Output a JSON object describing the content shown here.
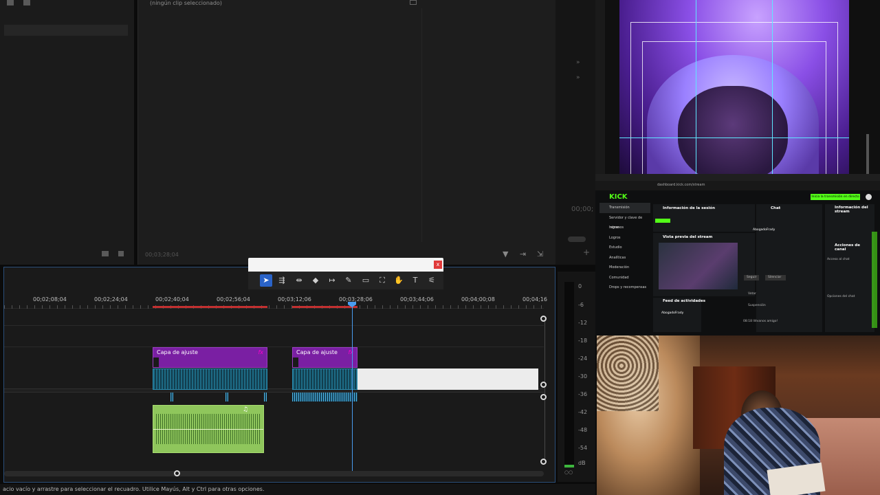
{
  "source_monitor": {
    "title": "(ningún clip seleccionado)",
    "timecode": "00;03;28;04"
  },
  "program_monitor": {
    "timecode_partial": "00;00;"
  },
  "timeline": {
    "ruler_labels": [
      "00;02;08;04",
      "00;02;24;04",
      "00;02;40;04",
      "00;02;56;04",
      "00;03;12;06",
      "00;03;28;06",
      "00;03;44;06",
      "00;04;00;08",
      "00;04;16"
    ],
    "clips": [
      {
        "name": "Capa de ajuste",
        "fx": "fx"
      },
      {
        "name": "Capa de ajuste",
        "fx": "fx"
      }
    ],
    "playhead_time": "00;03;28;06"
  },
  "toolbar": {
    "close_label": "x",
    "tools": [
      {
        "name": "selection-tool",
        "glyph": "➤"
      },
      {
        "name": "track-select-tool",
        "glyph": "⇶"
      },
      {
        "name": "ripple-edit-tool",
        "glyph": "⇹"
      },
      {
        "name": "razor-tool",
        "glyph": "◆"
      },
      {
        "name": "slip-tool",
        "glyph": "↦"
      },
      {
        "name": "pen-tool",
        "glyph": "✎"
      },
      {
        "name": "rectangle-tool",
        "glyph": "▭"
      },
      {
        "name": "crop-tool",
        "glyph": "⛶"
      },
      {
        "name": "hand-tool",
        "glyph": "✋"
      },
      {
        "name": "type-tool",
        "glyph": "T"
      },
      {
        "name": "remix-tool",
        "glyph": "⚟"
      }
    ]
  },
  "meters": {
    "db_labels": [
      "0",
      "-6",
      "-12",
      "-18",
      "-24",
      "-30",
      "-36",
      "-42",
      "-48",
      "-54",
      "dB"
    ]
  },
  "status_bar": {
    "text": "acio vacío y arrastre para seleccionar el recuadro. Utilice Mayús, Alt y Ctrl para otras opciones."
  },
  "kick_dashboard": {
    "url": "dashboard.kick.com/stream",
    "logo": "KICK",
    "go_live": "Inicia la transmisión en directo",
    "nav": [
      "Transmisión",
      "Servidor y clave de retran",
      "Ingresos",
      "Logros",
      "Estudio",
      "Analíticas",
      "Moderación",
      "Comunidad",
      "Drops y recompensas"
    ],
    "session_title": "Información de la sesión",
    "preview_title": "Vista previa del stream",
    "chat_title": "Chat",
    "stream_info_title": "Información del stream",
    "channel_actions": "Acciones de canal",
    "activity_feed": "Feed de actividades",
    "user": "AbogadoFrady",
    "follow": "Seguir",
    "mute": "Silenciar",
    "chat_access": "Acceso al chat",
    "chat_options": "Opciones del chat",
    "chat_msg": "08:18 llévanos amigo!",
    "vote": "Votar",
    "suspension": "Suspensión"
  },
  "colors": {
    "adjustment_clip": "#7a1fa3",
    "video_clip": "#1d6b85",
    "audio_clip": "#8fc65c",
    "playhead": "#4a9df0",
    "kick_green": "#53fc18"
  }
}
